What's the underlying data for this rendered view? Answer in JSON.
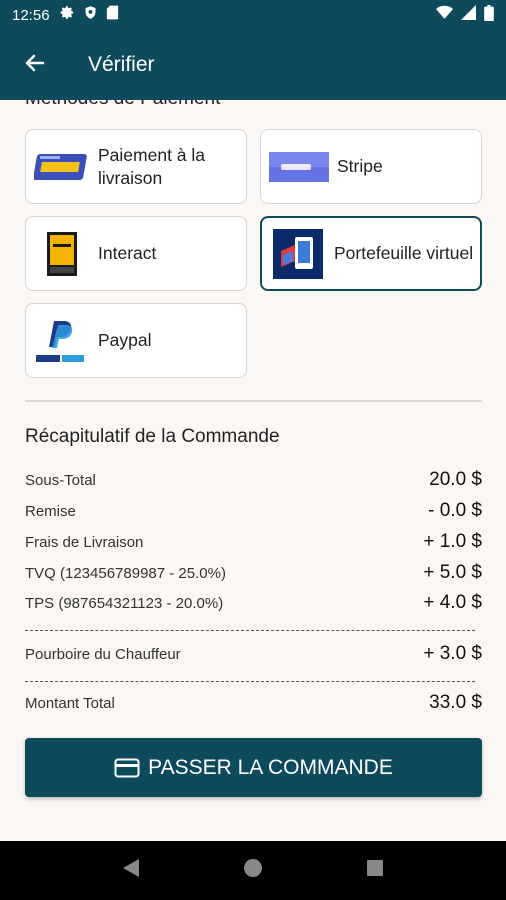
{
  "status_bar": {
    "time": "12:56",
    "icons": [
      "gear-icon",
      "shield-icon",
      "sd-card-icon",
      "wifi-icon",
      "signal-icon",
      "battery-icon"
    ]
  },
  "app_bar": {
    "title": "Vérifier",
    "back_icon": "arrow-left-icon"
  },
  "payment_methods": {
    "section_title": "Méthodes de Paiement",
    "items": [
      {
        "label": "Paiement à la livraison",
        "logo": "cash-on-delivery-logo",
        "selected": false
      },
      {
        "label": "Stripe",
        "logo": "stripe-logo",
        "selected": false
      },
      {
        "label": "Interact",
        "logo": "interac-logo",
        "selected": false
      },
      {
        "label": "Portefeuille virtuel",
        "logo": "virtual-wallet-logo",
        "selected": true
      },
      {
        "label": "Paypal",
        "logo": "paypal-logo",
        "selected": false
      }
    ]
  },
  "summary": {
    "title": "Récapitulatif de la Commande",
    "rows": [
      {
        "label": "Sous-Total",
        "value": "20.0 $"
      },
      {
        "label": "Remise",
        "value": "- 0.0 $"
      },
      {
        "label": "Frais de Livraison",
        "value": "+ 1.0 $"
      },
      {
        "label": "TVQ (123456789987 - 25.0%)",
        "value": "+ 5.0 $"
      },
      {
        "label": "TPS (987654321123 - 20.0%)",
        "value": "+ 4.0 $"
      }
    ],
    "tip": {
      "label": "Pourboire du Chauffeur",
      "value": "+ 3.0 $"
    },
    "total": {
      "label": "Montant Total",
      "value": "33.0 $"
    }
  },
  "order_button": {
    "label": "PASSER LA COMMANDE",
    "icon": "credit-card-icon"
  },
  "colors": {
    "primary": "#0d4a5b",
    "background": "#fbf7f4"
  }
}
